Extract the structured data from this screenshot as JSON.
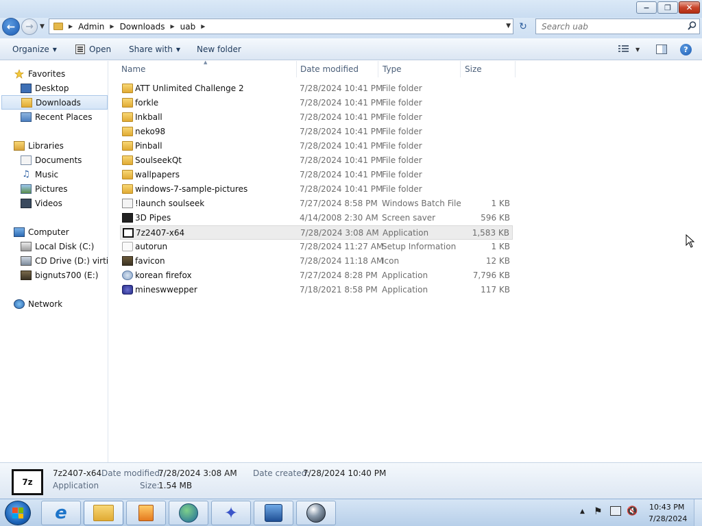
{
  "window": {
    "minimize": "−",
    "maximize": "❐",
    "close": "✕"
  },
  "address": {
    "crumbs": [
      "Admin",
      "Downloads",
      "uab"
    ]
  },
  "search": {
    "placeholder": "Search uab"
  },
  "toolbar": {
    "organize": "Organize",
    "open": "Open",
    "share_with": "Share with",
    "new_folder": "New folder",
    "help": "?"
  },
  "nav": {
    "favorites": "Favorites",
    "desktop": "Desktop",
    "downloads": "Downloads",
    "recent_places": "Recent Places",
    "libraries": "Libraries",
    "documents": "Documents",
    "music": "Music",
    "pictures": "Pictures",
    "videos": "Videos",
    "computer": "Computer",
    "local_disk": "Local Disk (C:)",
    "cd_drive": "CD Drive (D:) virtio-w",
    "bignuts": "bignuts700 (E:)",
    "network": "Network"
  },
  "columns": {
    "name": "Name",
    "date_modified": "Date modified",
    "type": "Type",
    "size": "Size"
  },
  "files": [
    {
      "name": "ATT Unlimited Challenge 2",
      "date": "7/28/2024 10:41 PM",
      "type": "File folder",
      "size": "",
      "icon": "folder-icon"
    },
    {
      "name": "forkle",
      "date": "7/28/2024 10:41 PM",
      "type": "File folder",
      "size": "",
      "icon": "folder-icon"
    },
    {
      "name": "Inkball",
      "date": "7/28/2024 10:41 PM",
      "type": "File folder",
      "size": "",
      "icon": "folder-icon"
    },
    {
      "name": "neko98",
      "date": "7/28/2024 10:41 PM",
      "type": "File folder",
      "size": "",
      "icon": "folder-icon"
    },
    {
      "name": "Pinball",
      "date": "7/28/2024 10:41 PM",
      "type": "File folder",
      "size": "",
      "icon": "folder-icon"
    },
    {
      "name": "SoulseekQt",
      "date": "7/28/2024 10:41 PM",
      "type": "File folder",
      "size": "",
      "icon": "folder-icon"
    },
    {
      "name": "wallpapers",
      "date": "7/28/2024 10:41 PM",
      "type": "File folder",
      "size": "",
      "icon": "folder-icon"
    },
    {
      "name": "windows-7-sample-pictures",
      "date": "7/28/2024 10:41 PM",
      "type": "File folder",
      "size": "",
      "icon": "folder-icon"
    },
    {
      "name": "!launch soulseek",
      "date": "7/27/2024 8:58 PM",
      "type": "Windows Batch File",
      "size": "1 KB",
      "icon": "batch-file-icon"
    },
    {
      "name": "3D Pipes",
      "date": "4/14/2008 2:30 AM",
      "type": "Screen saver",
      "size": "596 KB",
      "icon": "screensaver-icon"
    },
    {
      "name": "7z2407-x64",
      "date": "7/28/2024 3:08 AM",
      "type": "Application",
      "size": "1,583 KB",
      "icon": "7zip-icon"
    },
    {
      "name": "autorun",
      "date": "7/28/2024 11:27 AM",
      "type": "Setup Information",
      "size": "1 KB",
      "icon": "setup-info-icon"
    },
    {
      "name": "favicon",
      "date": "7/28/2024 11:18 AM",
      "type": "Icon",
      "size": "12 KB",
      "icon": "icon-file-icon"
    },
    {
      "name": "korean firefox",
      "date": "7/27/2024 8:28 PM",
      "type": "Application",
      "size": "7,796 KB",
      "icon": "firefox-icon"
    },
    {
      "name": "mineswwepper",
      "date": "7/18/2021 8:58 PM",
      "type": "Application",
      "size": "117 KB",
      "icon": "minesweeper-icon"
    }
  ],
  "selected_index": 10,
  "details": {
    "icon_text": "7z",
    "name": "7z2407-x64",
    "kind": "Application",
    "date_modified_label": "Date modified:",
    "date_modified": "7/28/2024 3:08 AM",
    "date_created_label": "Date created:",
    "date_created": "7/28/2024 10:40 PM",
    "size_label": "Size:",
    "size": "1.54 MB"
  },
  "taskbar": {
    "time": "10:43 PM",
    "date": "7/28/2024"
  }
}
